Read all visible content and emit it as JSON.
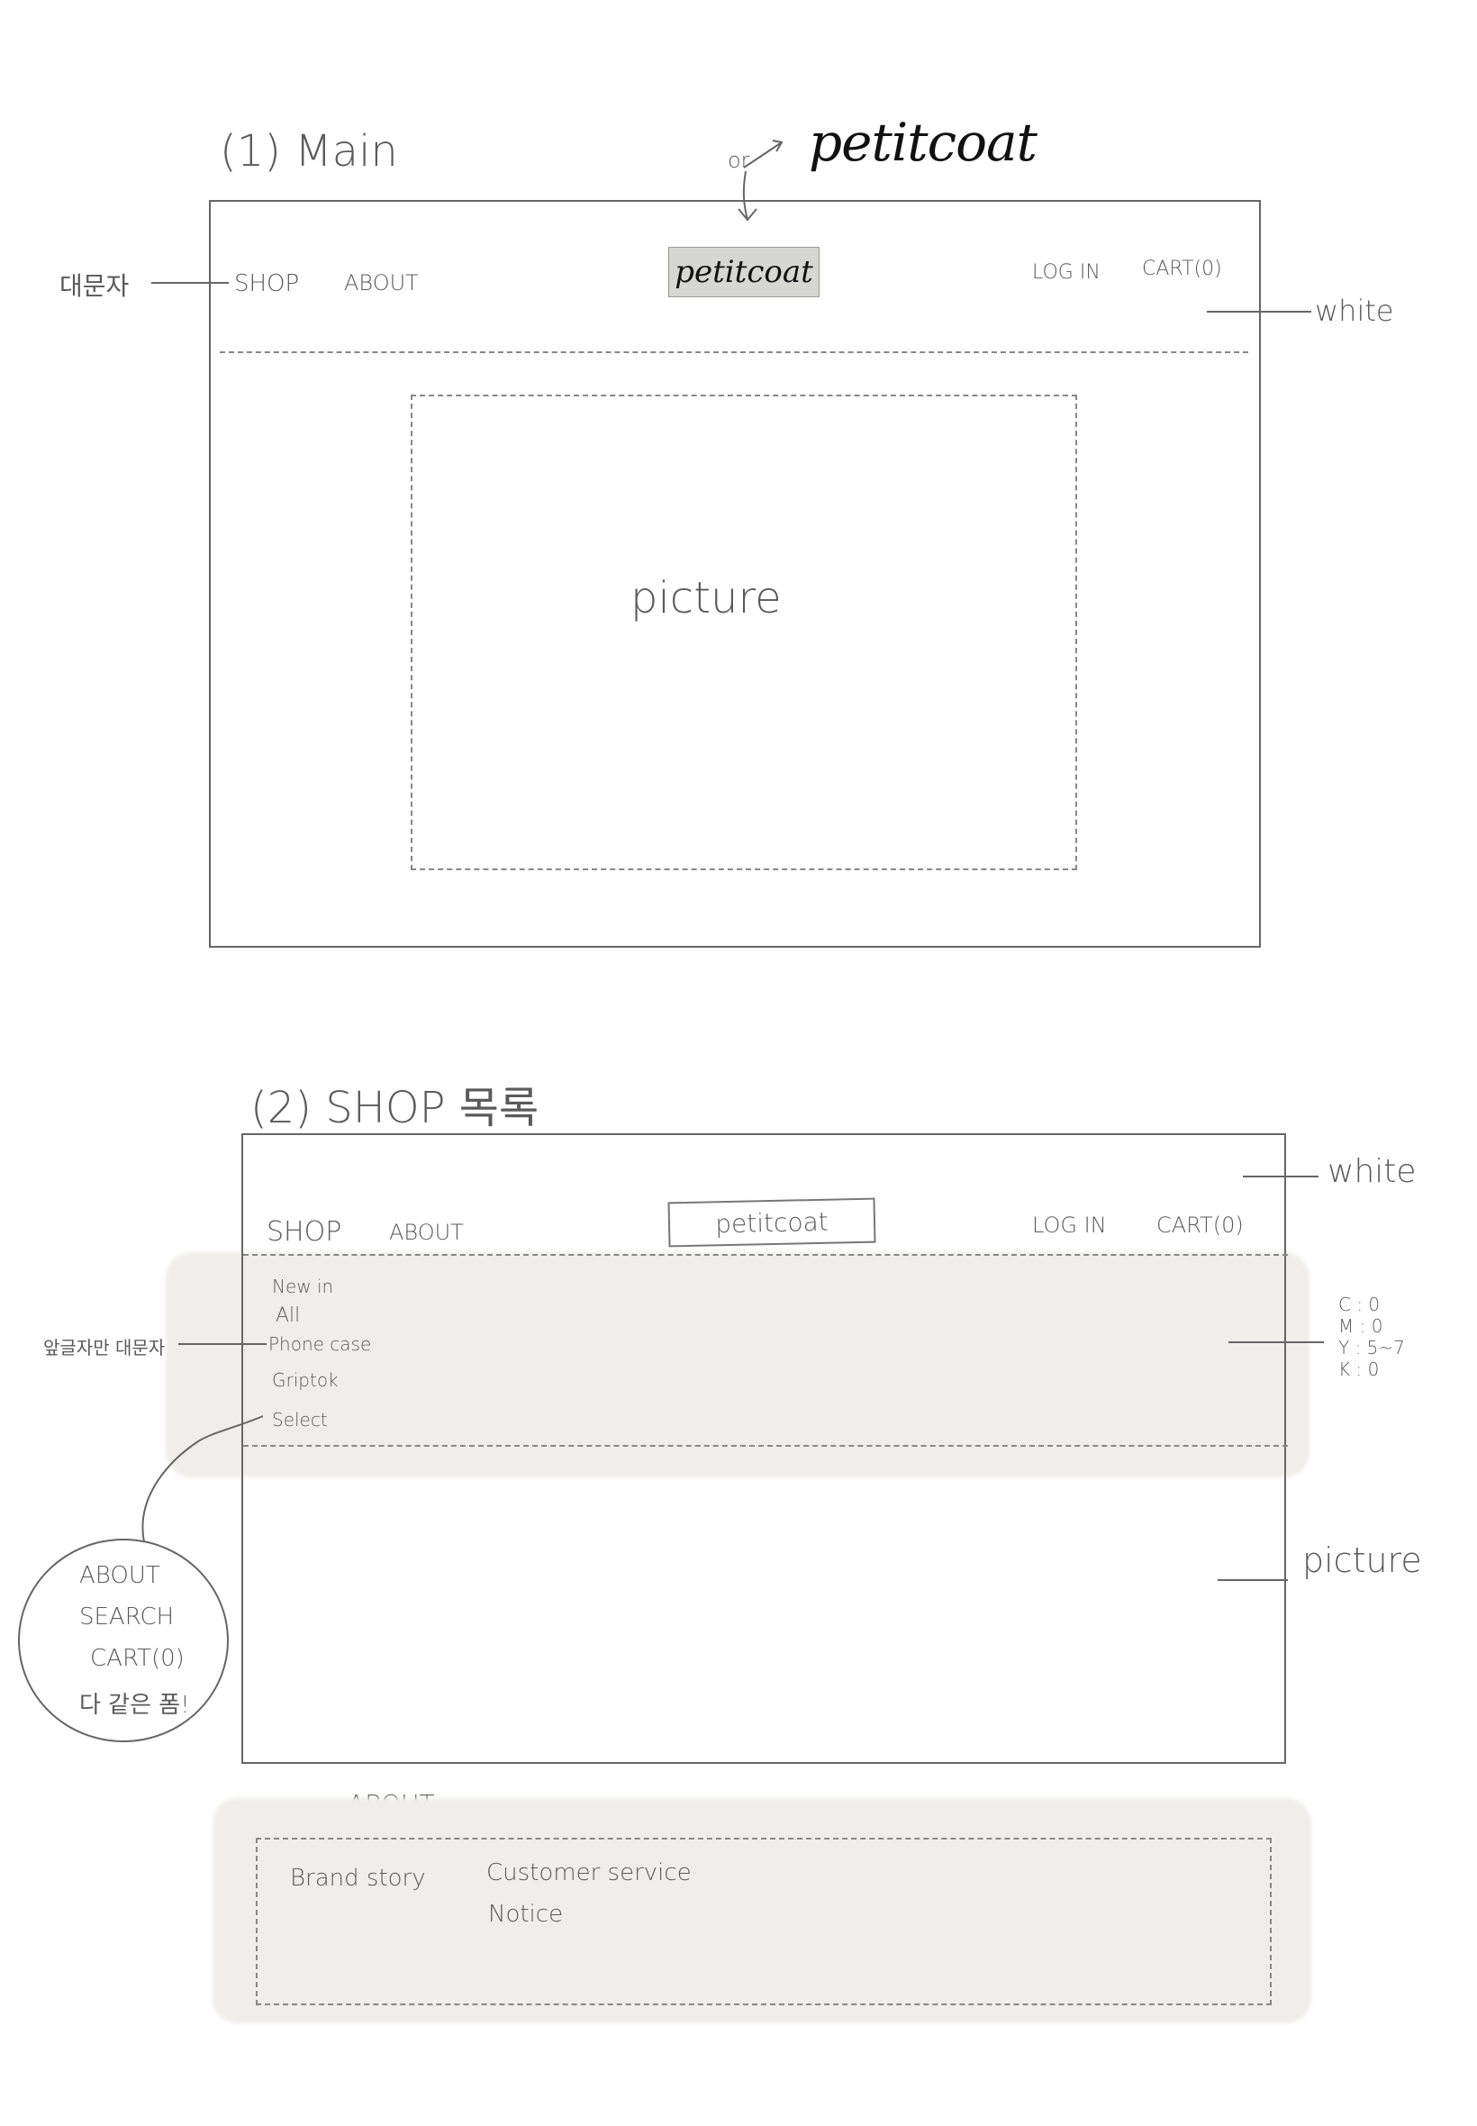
{
  "top_logo": "petitcoat",
  "top_logo_pointer": "or",
  "main": {
    "section_title": "(1) Main",
    "left_annotation": "대문자",
    "right_annotation": "white",
    "nav": {
      "shop": "SHOP",
      "about": "ABOUT",
      "logo": "petitcoat",
      "login": "LOG IN",
      "cart": "CART(0)"
    },
    "picture_label": "picture"
  },
  "shop": {
    "section_title": "(2) SHOP 목록",
    "right_annotation_top": "white",
    "nav": {
      "shop": "SHOP",
      "about": "ABOUT",
      "logo": "petitcoat",
      "login": "LOG IN",
      "cart": "CART(0)"
    },
    "menu_items": [
      "New in",
      "All",
      "Phone case",
      "Griptok",
      "Select"
    ],
    "left_annotation": "앞글자만 대문자",
    "cmyk_note": [
      "C : 0",
      "M : 0",
      "Y : 5~7",
      "K : 0"
    ],
    "picture_label": "picture",
    "circle_note": [
      "ABOUT",
      "SEARCH",
      "CART(0)",
      "다 같은 폼!"
    ]
  },
  "footer": {
    "title": "ABOUT",
    "links": {
      "brand_story": "Brand story",
      "customer_service": "Customer service",
      "notice": "Notice"
    }
  },
  "colors": {
    "pencil": "#666666",
    "wash": "#efeeea",
    "logo_fill": "#d6d6d2"
  }
}
